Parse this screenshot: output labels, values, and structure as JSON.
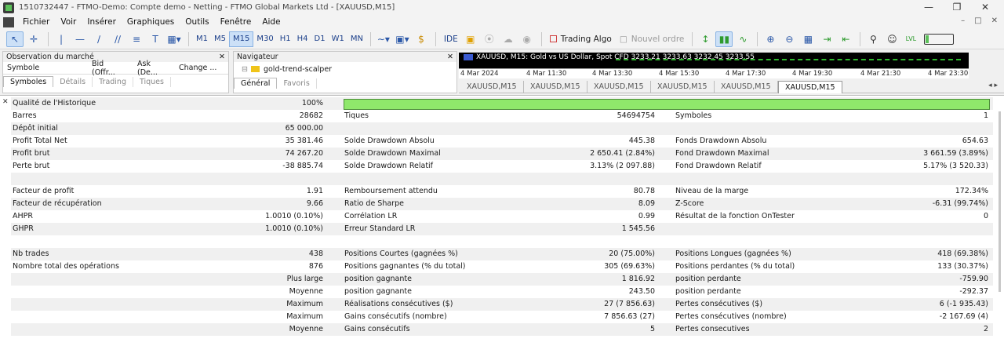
{
  "window": {
    "title": "1510732447 - FTMO-Demo: Compte demo - Netting - FTMO Global Markets Ltd - [XAUUSD,M15]",
    "min": "—",
    "max": "❐",
    "close": "✕"
  },
  "menu": [
    "Fichier",
    "Voir",
    "Insérer",
    "Graphiques",
    "Outils",
    "Fenêtre",
    "Aide"
  ],
  "toolbar": {
    "timeframes": [
      "M1",
      "M5",
      "M15",
      "M30",
      "H1",
      "H4",
      "D1",
      "W1",
      "MN"
    ],
    "selected_tf": "M15",
    "ide": "IDE",
    "algo": "Trading Algo",
    "new_order": "Nouvel ordre"
  },
  "market_watch": {
    "title": "Observation du marché",
    "cols": [
      "Symbole",
      "Bid (Offr...",
      "Ask (De...",
      "Change ..."
    ],
    "tabs": [
      "Symboles",
      "Détails",
      "Trading",
      "Tiques"
    ]
  },
  "navigator": {
    "title": "Navigateur",
    "item": "gold-trend-scalper",
    "tabs": [
      "Général",
      "Favoris"
    ]
  },
  "chart": {
    "title": "XAUUSD, M15:  Gold vs US Dollar, Spot CFD  3233.21 3233.63 3232.45 3233.55",
    "times": [
      "4 Mar 2024",
      "4 Mar 11:30",
      "4 Mar 13:30",
      "4 Mar 15:30",
      "4 Mar 17:30",
      "4 Mar 19:30",
      "4 Mar 21:30",
      "4 Mar 23:30"
    ],
    "tabs": [
      "XAUUSD,M15",
      "XAUUSD,M15",
      "XAUUSD,M15",
      "XAUUSD,M15",
      "XAUUSD,M15",
      "XAUUSD,M15"
    ]
  },
  "report": {
    "history_quality": {
      "label": "Qualité de l'Historique",
      "value": "100%",
      "fill": 1.0
    },
    "rows": [
      {
        "a": "Barres",
        "av": "28682",
        "b": "Tiques",
        "bv": "54694754",
        "c": "Symboles",
        "cv": "1"
      },
      {
        "a": "Dépôt initial",
        "av": "65 000.00",
        "b": "",
        "bv": "",
        "c": "",
        "cv": ""
      },
      {
        "a": "Profit Total Net",
        "av": "35 381.46",
        "b": "Solde Drawdown Absolu",
        "bv": "445.38",
        "c": "Fonds Drawdown Absolu",
        "cv": "654.63"
      },
      {
        "a": "Profit brut",
        "av": "74 267.20",
        "b": "Solde Drawdown Maximal",
        "bv": "2 650.41 (2.84%)",
        "c": "Fond Drawdown Maximal",
        "cv": "3 661.59 (3.89%)"
      },
      {
        "a": "Perte brut",
        "av": "-38 885.74",
        "b": "Solde Drawdown Relatif",
        "bv": "3.13% (2 097.88)",
        "c": "Fond Drawdown Relatif",
        "cv": "5.17% (3 520.33)"
      },
      {
        "a": "",
        "av": "",
        "b": "",
        "bv": "",
        "c": "",
        "cv": ""
      },
      {
        "a": "Facteur de profit",
        "av": "1.91",
        "b": "Remboursement attendu",
        "bv": "80.78",
        "c": "Niveau de la marge",
        "cv": "172.34%"
      },
      {
        "a": "Facteur de récupération",
        "av": "9.66",
        "b": "Ratio de Sharpe",
        "bv": "8.09",
        "c": "Z-Score",
        "cv": "-6.31 (99.74%)"
      },
      {
        "a": "AHPR",
        "av": "1.0010 (0.10%)",
        "b": "Corrélation LR",
        "bv": "0.99",
        "c": "Résultat de la fonction OnTester",
        "cv": "0"
      },
      {
        "a": "GHPR",
        "av": "1.0010 (0.10%)",
        "b": "Erreur Standard LR",
        "bv": "1 545.56",
        "c": "",
        "cv": ""
      },
      {
        "a": "",
        "av": "",
        "b": "",
        "bv": "",
        "c": "",
        "cv": ""
      },
      {
        "a": "Nb trades",
        "av": "438",
        "b": "Positions Courtes (gagnées %)",
        "bv": "20 (75.00%)",
        "c": "Positions Longues (gagnées %)",
        "cv": "418 (69.38%)"
      },
      {
        "a": "Nombre total des opérations",
        "av": "876",
        "b": "Positions gagnantes (% du total)",
        "bv": "305 (69.63%)",
        "c": "Positions perdantes (% du total)",
        "cv": "133 (30.37%)"
      },
      {
        "a": "",
        "av": "Plus large",
        "b": "position gagnante",
        "bv": "1 816.92",
        "c": "position perdante",
        "cv": "-759.90"
      },
      {
        "a": "",
        "av": "Moyenne",
        "b": "position gagnante",
        "bv": "243.50",
        "c": "position perdante",
        "cv": "-292.37"
      },
      {
        "a": "",
        "av": "Maximum",
        "b": "Réalisations consécutives ($)",
        "bv": "27 (7 856.63)",
        "c": "Pertes consécutives ($)",
        "cv": "6 (-1 935.43)"
      },
      {
        "a": "",
        "av": "Maximum",
        "b": "Gains consécutifs (nombre)",
        "bv": "7 856.63 (27)",
        "c": "Pertes consécutives (nombre)",
        "cv": "-2 167.69 (4)"
      },
      {
        "a": "",
        "av": "Moyenne",
        "b": "Gains consécutifs",
        "bv": "5",
        "c": "Pertes consecutives",
        "cv": "2"
      }
    ]
  }
}
